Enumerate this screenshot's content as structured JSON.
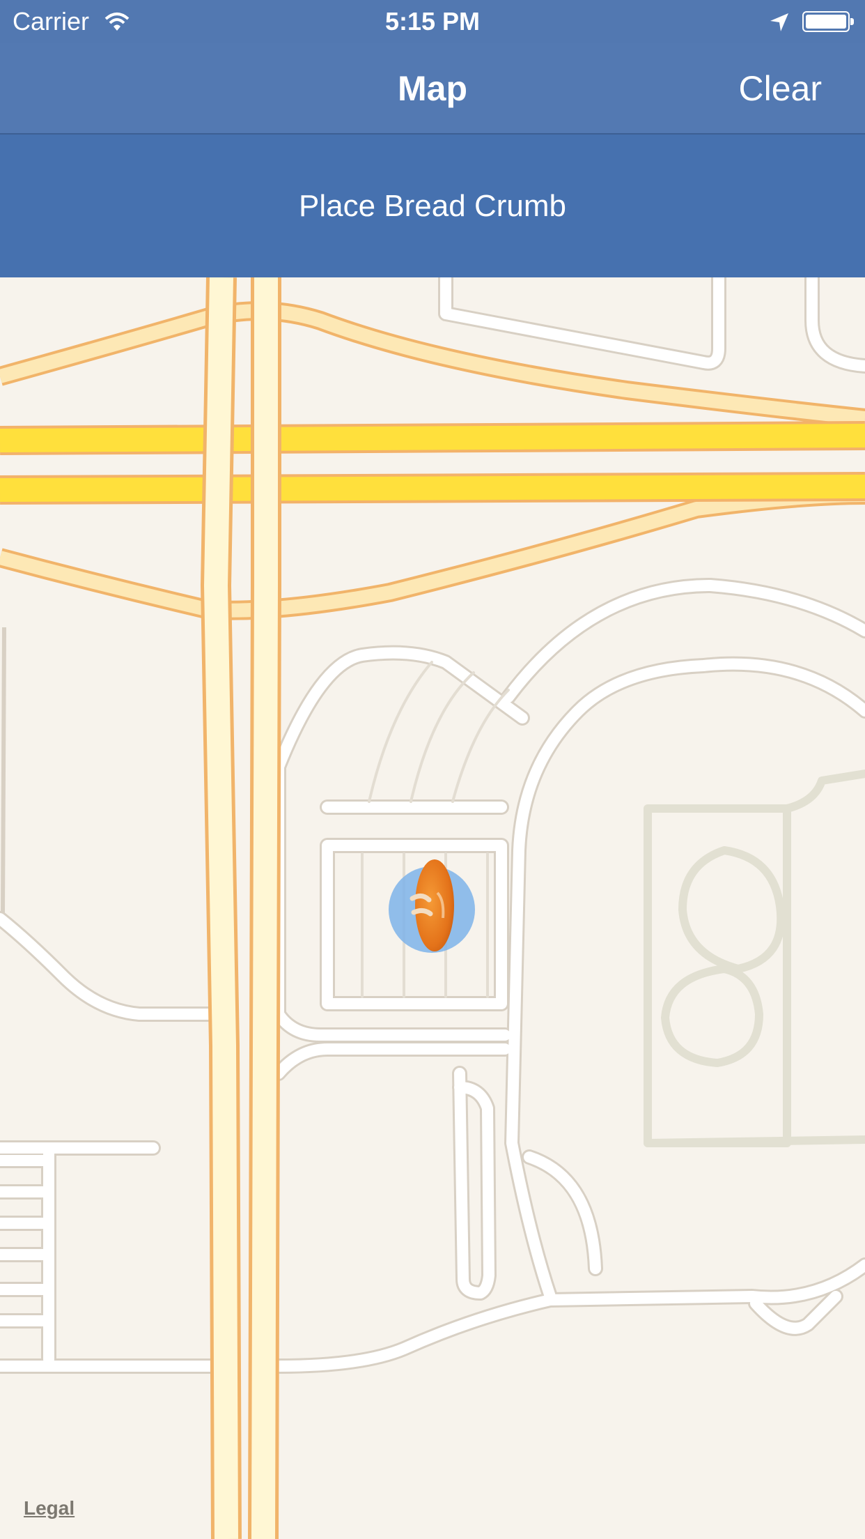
{
  "status_bar": {
    "carrier": "Carrier",
    "time": "5:15 PM",
    "icons": [
      "wifi-icon",
      "location-arrow-icon",
      "battery-icon"
    ]
  },
  "nav_bar": {
    "title": "Map",
    "clear_label": "Clear"
  },
  "action_bar": {
    "place_label": "Place Bread Crumb"
  },
  "map": {
    "legal_label": "Legal",
    "marker_icon": "bread-crumb-icon",
    "user_location_icon": "user-location-icon"
  },
  "colors": {
    "nav_background": "#5379b2",
    "action_background": "#4671af",
    "map_background": "#f7f3ec",
    "highway": "#ffe03c",
    "arterial": "#fff6c8",
    "marker": "#e8781e",
    "user_location": "#7eb3ea"
  }
}
